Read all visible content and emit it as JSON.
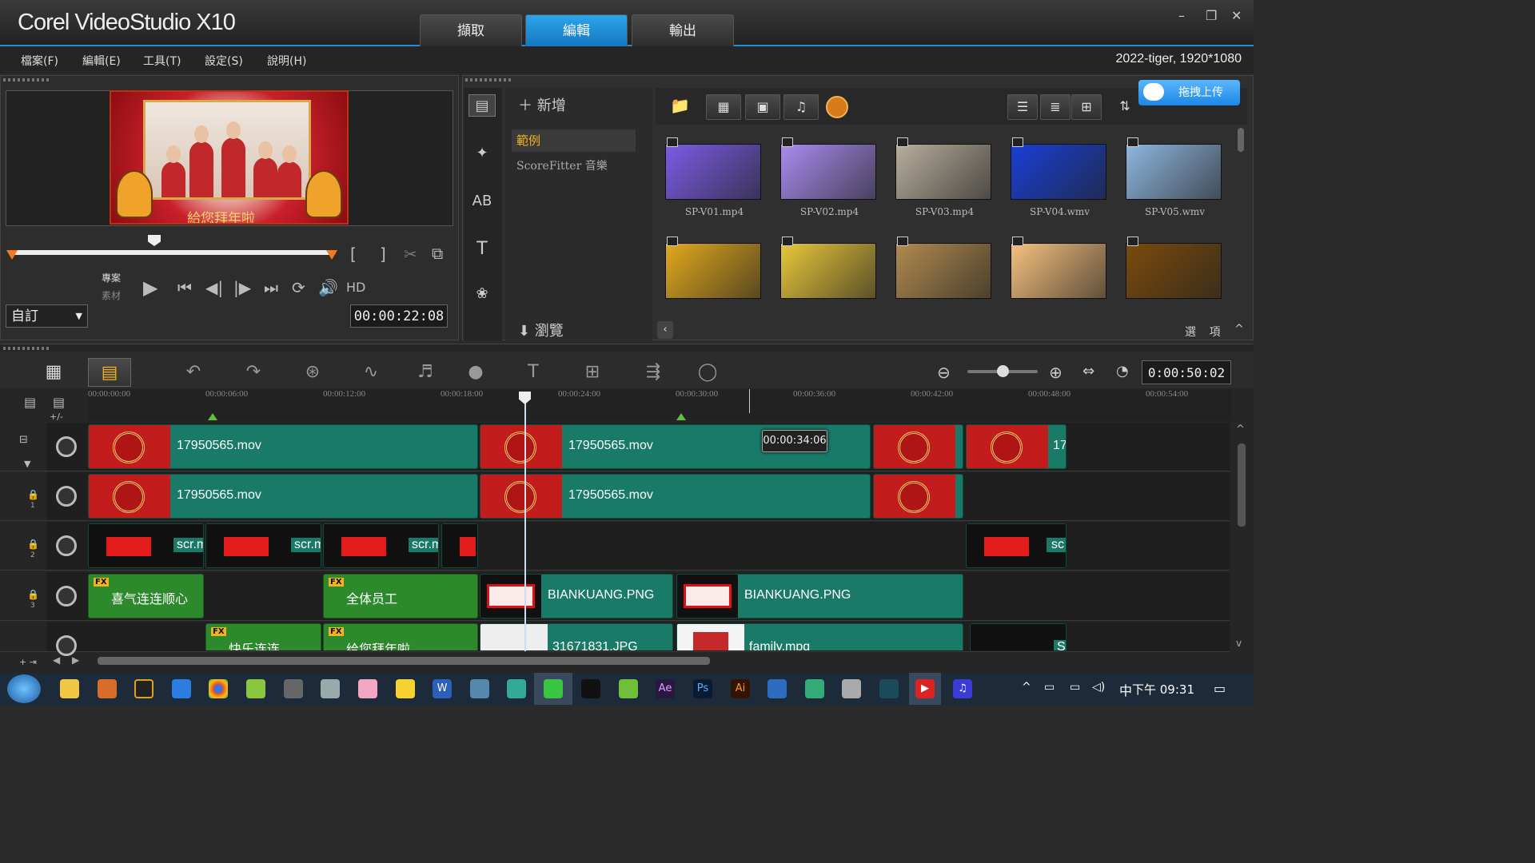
{
  "app": {
    "title": "Corel VideoStudio X10"
  },
  "tabs": [
    {
      "label": "擷取"
    },
    {
      "label": "編輯"
    },
    {
      "label": "輸出"
    }
  ],
  "window_controls": {
    "minimize": "–",
    "maximize": "❐",
    "close": "✕"
  },
  "menu": [
    {
      "label": "檔案(F)"
    },
    {
      "label": "編輯(E)"
    },
    {
      "label": "工具(T)"
    },
    {
      "label": "設定(S)"
    },
    {
      "label": "說明(H)"
    }
  ],
  "project_info": "2022-tiger, 1920*1080",
  "preview": {
    "caption": "給您拜年啦",
    "mode_labels": {
      "project": "專案",
      "clip": "素材"
    },
    "hd": "HD",
    "mode_select": "自訂",
    "timecode": "00:00:22:08",
    "trim_brackets": {
      "in": "[",
      "out": "]"
    }
  },
  "library": {
    "add_label": "新增",
    "folders": [
      {
        "label": "範例"
      },
      {
        "label": "ScoreFitter 音樂"
      }
    ],
    "browse_label": "瀏覽",
    "upload_button": "拖拽上传",
    "options_label": "選 項",
    "thumbnails": [
      {
        "label": "SP-V01.mp4",
        "color": "#7a5ce6"
      },
      {
        "label": "SP-V02.mp4",
        "color": "#a98cf0"
      },
      {
        "label": "SP-V03.mp4",
        "color": "#b7ae9c"
      },
      {
        "label": "SP-V04.wmv",
        "color": "#1a3fd6"
      },
      {
        "label": "SP-V05.wmv",
        "color": "#8fb6df"
      },
      {
        "label": "",
        "color": "#e1a81c"
      },
      {
        "label": "",
        "color": "#e8c73a"
      },
      {
        "label": "",
        "color": "#b08a4e"
      },
      {
        "label": "",
        "color": "#f6c07d"
      },
      {
        "label": "",
        "color": "#7a4b0b"
      }
    ]
  },
  "timeline": {
    "timecode": "0:00:50:02",
    "tooltip": "00:00:34:06",
    "ruler_ticks": [
      "00:00:00:00",
      "00:00:06:00",
      "00:00:12:00",
      "00:00:18:00",
      "00:00:24:00",
      "00:00:30:00",
      "00:00:36:00",
      "00:00:42:00",
      "00:00:48:00",
      "00:00:54:00"
    ],
    "track_numbers": [
      "1",
      "2",
      "3"
    ],
    "clip_names": {
      "mov": "17950565.mov",
      "mov_short": "17",
      "scr": "scr.m",
      "scr_short": "sc",
      "title1": "喜气连连顺心",
      "title2": "全体员工",
      "title3": "快乐连连",
      "title4": "给您拜年啦",
      "bk": "BIANKUANG.PNG",
      "jpg": "31671831.JPG",
      "mpg": "family.mpg",
      "s": "S"
    }
  },
  "taskbar": {
    "time": "下午 09:31",
    "ime": "中"
  }
}
